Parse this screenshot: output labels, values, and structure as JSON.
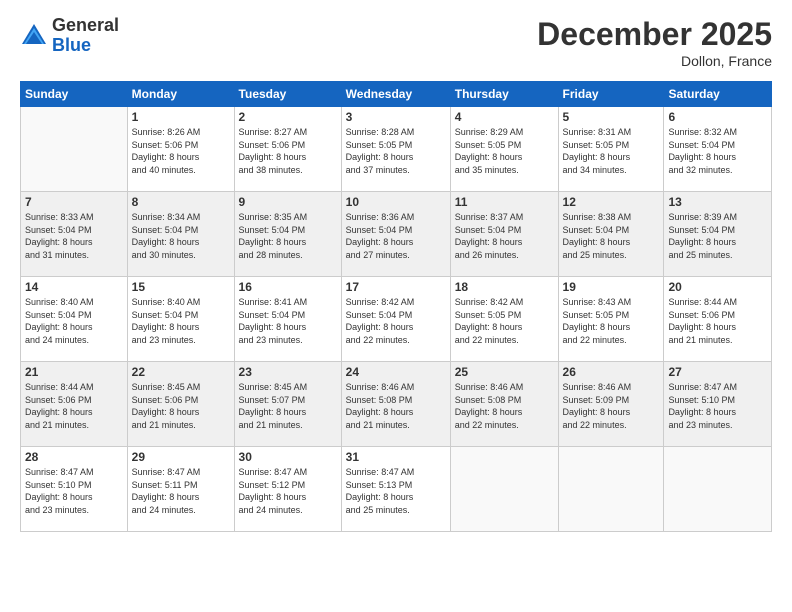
{
  "header": {
    "logo_general": "General",
    "logo_blue": "Blue",
    "month_title": "December 2025",
    "location": "Dollon, France"
  },
  "weekdays": [
    "Sunday",
    "Monday",
    "Tuesday",
    "Wednesday",
    "Thursday",
    "Friday",
    "Saturday"
  ],
  "weeks": [
    [
      {
        "day": "",
        "info": ""
      },
      {
        "day": "1",
        "info": "Sunrise: 8:26 AM\nSunset: 5:06 PM\nDaylight: 8 hours\nand 40 minutes."
      },
      {
        "day": "2",
        "info": "Sunrise: 8:27 AM\nSunset: 5:06 PM\nDaylight: 8 hours\nand 38 minutes."
      },
      {
        "day": "3",
        "info": "Sunrise: 8:28 AM\nSunset: 5:05 PM\nDaylight: 8 hours\nand 37 minutes."
      },
      {
        "day": "4",
        "info": "Sunrise: 8:29 AM\nSunset: 5:05 PM\nDaylight: 8 hours\nand 35 minutes."
      },
      {
        "day": "5",
        "info": "Sunrise: 8:31 AM\nSunset: 5:05 PM\nDaylight: 8 hours\nand 34 minutes."
      },
      {
        "day": "6",
        "info": "Sunrise: 8:32 AM\nSunset: 5:04 PM\nDaylight: 8 hours\nand 32 minutes."
      }
    ],
    [
      {
        "day": "7",
        "info": "Sunrise: 8:33 AM\nSunset: 5:04 PM\nDaylight: 8 hours\nand 31 minutes."
      },
      {
        "day": "8",
        "info": "Sunrise: 8:34 AM\nSunset: 5:04 PM\nDaylight: 8 hours\nand 30 minutes."
      },
      {
        "day": "9",
        "info": "Sunrise: 8:35 AM\nSunset: 5:04 PM\nDaylight: 8 hours\nand 28 minutes."
      },
      {
        "day": "10",
        "info": "Sunrise: 8:36 AM\nSunset: 5:04 PM\nDaylight: 8 hours\nand 27 minutes."
      },
      {
        "day": "11",
        "info": "Sunrise: 8:37 AM\nSunset: 5:04 PM\nDaylight: 8 hours\nand 26 minutes."
      },
      {
        "day": "12",
        "info": "Sunrise: 8:38 AM\nSunset: 5:04 PM\nDaylight: 8 hours\nand 25 minutes."
      },
      {
        "day": "13",
        "info": "Sunrise: 8:39 AM\nSunset: 5:04 PM\nDaylight: 8 hours\nand 25 minutes."
      }
    ],
    [
      {
        "day": "14",
        "info": "Sunrise: 8:40 AM\nSunset: 5:04 PM\nDaylight: 8 hours\nand 24 minutes."
      },
      {
        "day": "15",
        "info": "Sunrise: 8:40 AM\nSunset: 5:04 PM\nDaylight: 8 hours\nand 23 minutes."
      },
      {
        "day": "16",
        "info": "Sunrise: 8:41 AM\nSunset: 5:04 PM\nDaylight: 8 hours\nand 23 minutes."
      },
      {
        "day": "17",
        "info": "Sunrise: 8:42 AM\nSunset: 5:04 PM\nDaylight: 8 hours\nand 22 minutes."
      },
      {
        "day": "18",
        "info": "Sunrise: 8:42 AM\nSunset: 5:05 PM\nDaylight: 8 hours\nand 22 minutes."
      },
      {
        "day": "19",
        "info": "Sunrise: 8:43 AM\nSunset: 5:05 PM\nDaylight: 8 hours\nand 22 minutes."
      },
      {
        "day": "20",
        "info": "Sunrise: 8:44 AM\nSunset: 5:06 PM\nDaylight: 8 hours\nand 21 minutes."
      }
    ],
    [
      {
        "day": "21",
        "info": "Sunrise: 8:44 AM\nSunset: 5:06 PM\nDaylight: 8 hours\nand 21 minutes."
      },
      {
        "day": "22",
        "info": "Sunrise: 8:45 AM\nSunset: 5:06 PM\nDaylight: 8 hours\nand 21 minutes."
      },
      {
        "day": "23",
        "info": "Sunrise: 8:45 AM\nSunset: 5:07 PM\nDaylight: 8 hours\nand 21 minutes."
      },
      {
        "day": "24",
        "info": "Sunrise: 8:46 AM\nSunset: 5:08 PM\nDaylight: 8 hours\nand 21 minutes."
      },
      {
        "day": "25",
        "info": "Sunrise: 8:46 AM\nSunset: 5:08 PM\nDaylight: 8 hours\nand 22 minutes."
      },
      {
        "day": "26",
        "info": "Sunrise: 8:46 AM\nSunset: 5:09 PM\nDaylight: 8 hours\nand 22 minutes."
      },
      {
        "day": "27",
        "info": "Sunrise: 8:47 AM\nSunset: 5:10 PM\nDaylight: 8 hours\nand 23 minutes."
      }
    ],
    [
      {
        "day": "28",
        "info": "Sunrise: 8:47 AM\nSunset: 5:10 PM\nDaylight: 8 hours\nand 23 minutes."
      },
      {
        "day": "29",
        "info": "Sunrise: 8:47 AM\nSunset: 5:11 PM\nDaylight: 8 hours\nand 24 minutes."
      },
      {
        "day": "30",
        "info": "Sunrise: 8:47 AM\nSunset: 5:12 PM\nDaylight: 8 hours\nand 24 minutes."
      },
      {
        "day": "31",
        "info": "Sunrise: 8:47 AM\nSunset: 5:13 PM\nDaylight: 8 hours\nand 25 minutes."
      },
      {
        "day": "",
        "info": ""
      },
      {
        "day": "",
        "info": ""
      },
      {
        "day": "",
        "info": ""
      }
    ]
  ]
}
